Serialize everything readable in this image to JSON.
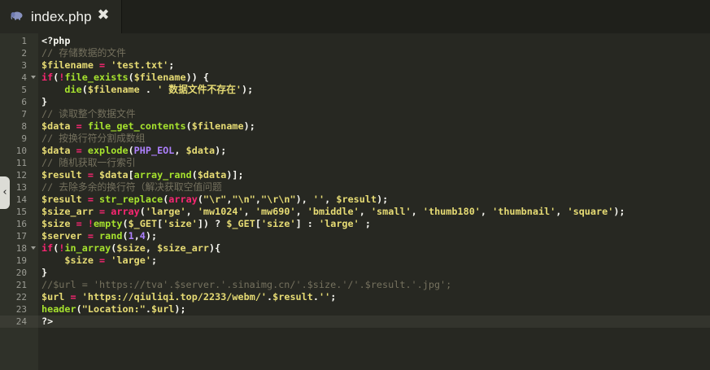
{
  "tab": {
    "title": "index.php",
    "close_glyph": "✖",
    "icon": "php-elephant-icon"
  },
  "editor": {
    "active_line": 24,
    "theme_colors": {
      "background": "#272822",
      "gutter": "#2f3129",
      "keyword": "#f92672",
      "function": "#a6e22e",
      "string": "#e6db74",
      "comment": "#75715e",
      "constant": "#ae81ff"
    },
    "collapse_handle_glyph": "‹",
    "lines": [
      {
        "num": "1",
        "fold": false,
        "tokens": [
          [
            "t-plain",
            "<?php"
          ]
        ]
      },
      {
        "num": "2",
        "fold": false,
        "tokens": [
          [
            "t-cmt",
            "// 存储数据的文件"
          ]
        ]
      },
      {
        "num": "3",
        "fold": false,
        "tokens": [
          [
            "t-var",
            "$filename"
          ],
          [
            "t-plain",
            " "
          ],
          [
            "t-op",
            "="
          ],
          [
            "t-plain",
            " "
          ],
          [
            "t-str",
            "'test.txt'"
          ],
          [
            "t-plain",
            ";"
          ]
        ]
      },
      {
        "num": "4",
        "fold": true,
        "tokens": [
          [
            "t-kw",
            "if"
          ],
          [
            "t-plain",
            "("
          ],
          [
            "t-op",
            "!"
          ],
          [
            "t-fn",
            "file_exists"
          ],
          [
            "t-plain",
            "("
          ],
          [
            "t-var",
            "$filename"
          ],
          [
            "t-plain",
            ")) {"
          ]
        ]
      },
      {
        "num": "5",
        "fold": false,
        "tokens": [
          [
            "t-plain",
            "    "
          ],
          [
            "t-fn",
            "die"
          ],
          [
            "t-plain",
            "("
          ],
          [
            "t-var",
            "$filename"
          ],
          [
            "t-plain",
            " . "
          ],
          [
            "t-str",
            "' 数据文件不存在'"
          ],
          [
            "t-plain",
            ");"
          ]
        ]
      },
      {
        "num": "6",
        "fold": false,
        "tokens": [
          [
            "t-plain",
            "}"
          ]
        ]
      },
      {
        "num": "7",
        "fold": false,
        "tokens": [
          [
            "t-cmt",
            "// 读取整个数据文件"
          ]
        ]
      },
      {
        "num": "8",
        "fold": false,
        "tokens": [
          [
            "t-var",
            "$data"
          ],
          [
            "t-plain",
            " "
          ],
          [
            "t-op",
            "="
          ],
          [
            "t-plain",
            " "
          ],
          [
            "t-fn",
            "file_get_contents"
          ],
          [
            "t-plain",
            "("
          ],
          [
            "t-var",
            "$filename"
          ],
          [
            "t-plain",
            ");"
          ]
        ]
      },
      {
        "num": "9",
        "fold": false,
        "tokens": [
          [
            "t-cmt",
            "// 按换行符分割成数组"
          ]
        ]
      },
      {
        "num": "10",
        "fold": false,
        "tokens": [
          [
            "t-var",
            "$data"
          ],
          [
            "t-plain",
            " "
          ],
          [
            "t-op",
            "="
          ],
          [
            "t-plain",
            " "
          ],
          [
            "t-fn",
            "explode"
          ],
          [
            "t-plain",
            "("
          ],
          [
            "t-const",
            "PHP_EOL"
          ],
          [
            "t-plain",
            ", "
          ],
          [
            "t-var",
            "$data"
          ],
          [
            "t-plain",
            ");"
          ]
        ]
      },
      {
        "num": "11",
        "fold": false,
        "tokens": [
          [
            "t-cmt",
            "// 随机获取一行索引"
          ]
        ]
      },
      {
        "num": "12",
        "fold": false,
        "tokens": [
          [
            "t-var",
            "$result"
          ],
          [
            "t-plain",
            " "
          ],
          [
            "t-op",
            "="
          ],
          [
            "t-plain",
            " "
          ],
          [
            "t-var",
            "$data"
          ],
          [
            "t-plain",
            "["
          ],
          [
            "t-fn",
            "array_rand"
          ],
          [
            "t-plain",
            "("
          ],
          [
            "t-var",
            "$data"
          ],
          [
            "t-plain",
            ")];"
          ]
        ]
      },
      {
        "num": "13",
        "fold": false,
        "tokens": [
          [
            "t-cmt",
            "// 去除多余的换行符（解决获取空值问题"
          ]
        ]
      },
      {
        "num": "14",
        "fold": false,
        "tokens": [
          [
            "t-var",
            "$result"
          ],
          [
            "t-plain",
            " "
          ],
          [
            "t-op",
            "="
          ],
          [
            "t-plain",
            " "
          ],
          [
            "t-fn",
            "str_replace"
          ],
          [
            "t-plain",
            "("
          ],
          [
            "t-kw",
            "array"
          ],
          [
            "t-plain",
            "("
          ],
          [
            "t-str",
            "\"\\r\""
          ],
          [
            "t-plain",
            ","
          ],
          [
            "t-str",
            "\"\\n\""
          ],
          [
            "t-plain",
            ","
          ],
          [
            "t-str",
            "\"\\r\\n\""
          ],
          [
            "t-plain",
            "), "
          ],
          [
            "t-str",
            "''"
          ],
          [
            "t-plain",
            ", "
          ],
          [
            "t-var",
            "$result"
          ],
          [
            "t-plain",
            ");"
          ]
        ]
      },
      {
        "num": "15",
        "fold": false,
        "tokens": [
          [
            "t-var",
            "$size_arr"
          ],
          [
            "t-plain",
            " "
          ],
          [
            "t-op",
            "="
          ],
          [
            "t-plain",
            " "
          ],
          [
            "t-kw",
            "array"
          ],
          [
            "t-plain",
            "("
          ],
          [
            "t-str",
            "'large'"
          ],
          [
            "t-plain",
            ", "
          ],
          [
            "t-str",
            "'mw1024'"
          ],
          [
            "t-plain",
            ", "
          ],
          [
            "t-str",
            "'mw690'"
          ],
          [
            "t-plain",
            ", "
          ],
          [
            "t-str",
            "'bmiddle'"
          ],
          [
            "t-plain",
            ", "
          ],
          [
            "t-str",
            "'small'"
          ],
          [
            "t-plain",
            ", "
          ],
          [
            "t-str",
            "'thumb180'"
          ],
          [
            "t-plain",
            ", "
          ],
          [
            "t-str",
            "'thumbnail'"
          ],
          [
            "t-plain",
            ", "
          ],
          [
            "t-str",
            "'square'"
          ],
          [
            "t-plain",
            ");"
          ]
        ]
      },
      {
        "num": "16",
        "fold": false,
        "tokens": [
          [
            "t-var",
            "$size"
          ],
          [
            "t-plain",
            " "
          ],
          [
            "t-op",
            "="
          ],
          [
            "t-plain",
            " "
          ],
          [
            "t-op",
            "!"
          ],
          [
            "t-fn",
            "empty"
          ],
          [
            "t-plain",
            "("
          ],
          [
            "t-var",
            "$_GET"
          ],
          [
            "t-plain",
            "["
          ],
          [
            "t-str",
            "'size'"
          ],
          [
            "t-plain",
            "]) ? "
          ],
          [
            "t-var",
            "$_GET"
          ],
          [
            "t-plain",
            "["
          ],
          [
            "t-str",
            "'size'"
          ],
          [
            "t-plain",
            "] : "
          ],
          [
            "t-str",
            "'large'"
          ],
          [
            "t-plain",
            " ;"
          ]
        ]
      },
      {
        "num": "17",
        "fold": false,
        "tokens": [
          [
            "t-var",
            "$server"
          ],
          [
            "t-plain",
            " "
          ],
          [
            "t-op",
            "="
          ],
          [
            "t-plain",
            " "
          ],
          [
            "t-fn",
            "rand"
          ],
          [
            "t-plain",
            "("
          ],
          [
            "t-const",
            "1"
          ],
          [
            "t-plain",
            ","
          ],
          [
            "t-const",
            "4"
          ],
          [
            "t-plain",
            ");"
          ]
        ]
      },
      {
        "num": "18",
        "fold": true,
        "tokens": [
          [
            "t-kw",
            "if"
          ],
          [
            "t-plain",
            "("
          ],
          [
            "t-op",
            "!"
          ],
          [
            "t-fn",
            "in_array"
          ],
          [
            "t-plain",
            "("
          ],
          [
            "t-var",
            "$size"
          ],
          [
            "t-plain",
            ", "
          ],
          [
            "t-var",
            "$size_arr"
          ],
          [
            "t-plain",
            "){"
          ]
        ]
      },
      {
        "num": "19",
        "fold": false,
        "tokens": [
          [
            "t-plain",
            "    "
          ],
          [
            "t-var",
            "$size"
          ],
          [
            "t-plain",
            " "
          ],
          [
            "t-op",
            "="
          ],
          [
            "t-plain",
            " "
          ],
          [
            "t-str",
            "'large'"
          ],
          [
            "t-plain",
            ";"
          ]
        ]
      },
      {
        "num": "20",
        "fold": false,
        "tokens": [
          [
            "t-plain",
            "}"
          ]
        ]
      },
      {
        "num": "21",
        "fold": false,
        "tokens": [
          [
            "t-cmt",
            "//$url = 'https://tva'.$server.'.sinaimg.cn/'.$size.'/'.$result.'.jpg';"
          ]
        ]
      },
      {
        "num": "22",
        "fold": false,
        "tokens": [
          [
            "t-var",
            "$url"
          ],
          [
            "t-plain",
            " "
          ],
          [
            "t-op",
            "="
          ],
          [
            "t-plain",
            " "
          ],
          [
            "t-str",
            "'https://qiuliqi.top/2233/webm/'"
          ],
          [
            "t-plain",
            "."
          ],
          [
            "t-var",
            "$result"
          ],
          [
            "t-plain",
            "."
          ],
          [
            "t-str",
            "''"
          ],
          [
            "t-plain",
            ";"
          ]
        ]
      },
      {
        "num": "23",
        "fold": false,
        "tokens": [
          [
            "t-fn",
            "header"
          ],
          [
            "t-plain",
            "("
          ],
          [
            "t-str",
            "\"Location:\""
          ],
          [
            "t-plain",
            "."
          ],
          [
            "t-var",
            "$url"
          ],
          [
            "t-plain",
            ");"
          ]
        ]
      },
      {
        "num": "24",
        "fold": false,
        "tokens": [
          [
            "t-plain",
            "?>"
          ]
        ]
      }
    ]
  }
}
